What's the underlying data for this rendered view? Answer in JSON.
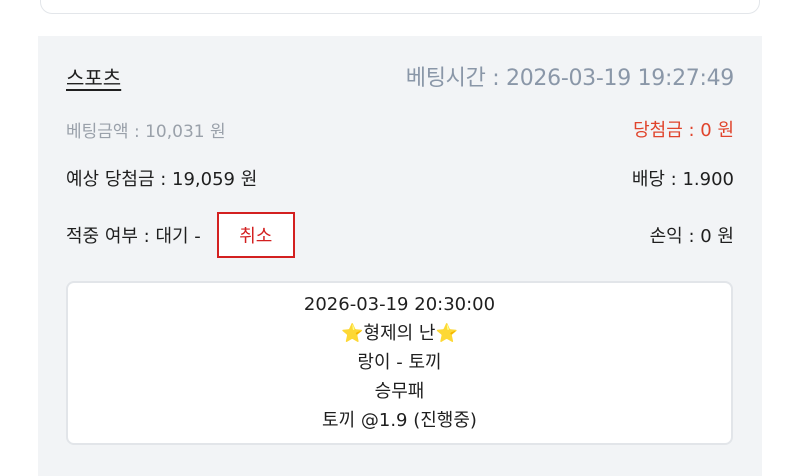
{
  "bet": {
    "type_label": "스포츠",
    "bet_time": "베팅시간 : 2026-03-19 19:27:49",
    "bet_amount": "베팅금액 : 10,031 원",
    "win_amount": "당첨금 : 0 원",
    "expected_win": "예상 당첨금 : 19,059 원",
    "odds": "배당 : 1.900",
    "hit_status": "적중 여부 : 대기 -",
    "cancel_label": "취소",
    "profit": "손익 : 0 원"
  },
  "detail": {
    "datetime": "2026-03-19 20:30:00",
    "league_name": "형제의 난",
    "league_icon": "star-icon",
    "teams": "랑이 - 토끼",
    "market": "승무패",
    "selection": "토끼 @1.9 (진행중)"
  },
  "colors": {
    "accent_red": "#d32020",
    "win_red": "#e0442c",
    "muted_gray": "#9aa1aa",
    "time_gray": "#8a97a8",
    "card_bg": "#f2f4f6"
  }
}
